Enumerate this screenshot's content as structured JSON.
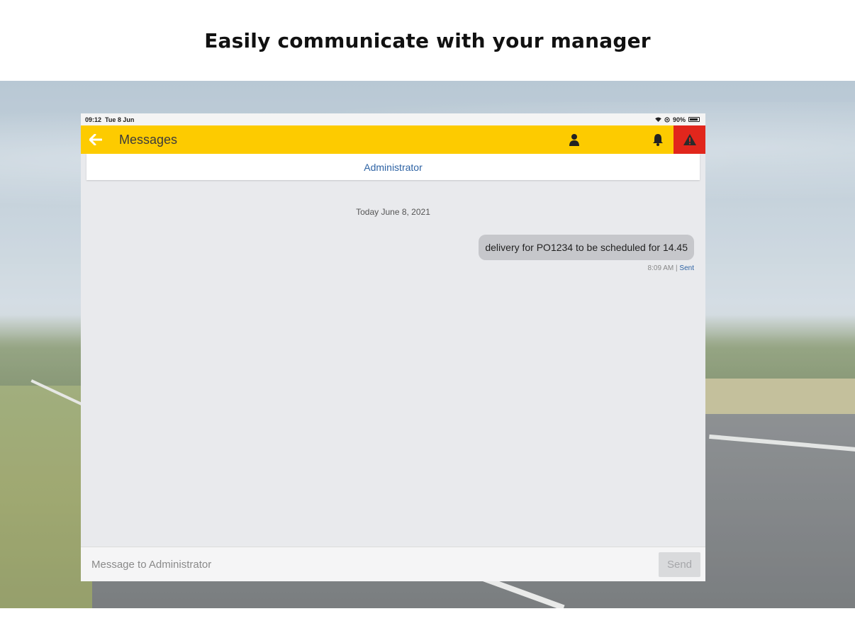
{
  "headline": "Easily communicate with your manager",
  "status_bar": {
    "time": "09:12",
    "date": "Tue 8 Jun",
    "battery": "90%"
  },
  "app_bar": {
    "title": "Messages",
    "back_icon": "arrow-left-icon",
    "user_icon": "person-icon",
    "bell_icon": "bell-icon",
    "alert_icon": "warning-triangle-icon",
    "alert_color": "#e1261c",
    "bar_color": "#fdcb00"
  },
  "conversation": {
    "recipient": "Administrator",
    "date_divider": "Today June 8, 2021",
    "messages": [
      {
        "text": "delivery for PO1234 to be scheduled for 14.45",
        "time": "8:09 AM",
        "separator": "|",
        "status": "Sent"
      }
    ]
  },
  "composer": {
    "placeholder": "Message to Administrator",
    "value": "",
    "send_label": "Send"
  }
}
